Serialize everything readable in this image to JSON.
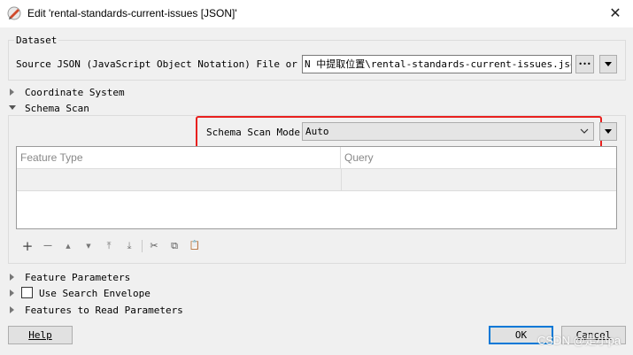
{
  "window": {
    "title": "Edit 'rental-standards-current-issues [JSON]'",
    "close_glyph": "✕"
  },
  "dataset": {
    "legend": "Dataset",
    "source_label": "Source JSON (JavaScript Object Notation) File or URL:",
    "source_value": "N 中提取位置\\rental-standards-current-issues.json\"",
    "browse_glyph": "•••"
  },
  "sections": {
    "coordinate_system": "Coordinate System",
    "schema_scan": "Schema Scan",
    "feature_parameters": "Feature Parameters",
    "use_search_envelope": "Use Search Envelope",
    "features_to_read": "Features to Read Parameters"
  },
  "schema_scan": {
    "mode_label": "Schema Scan Mode:",
    "mode_value": "Auto",
    "table_headers": [
      "Feature Type",
      "Query"
    ]
  },
  "toolbar": {
    "add": "+",
    "remove": "—",
    "move_up": "▲",
    "move_down": "▼",
    "move_top": "⤒",
    "move_bottom": "⤓",
    "cut": "✂",
    "copy": "⧉",
    "paste": "📋"
  },
  "buttons": {
    "help": "Help",
    "ok": "OK",
    "cancel": "Cancel"
  },
  "watermark": "CSDN @是小pa",
  "colors": {
    "highlight": "#e8201e",
    "ok_border": "#0078d7"
  }
}
